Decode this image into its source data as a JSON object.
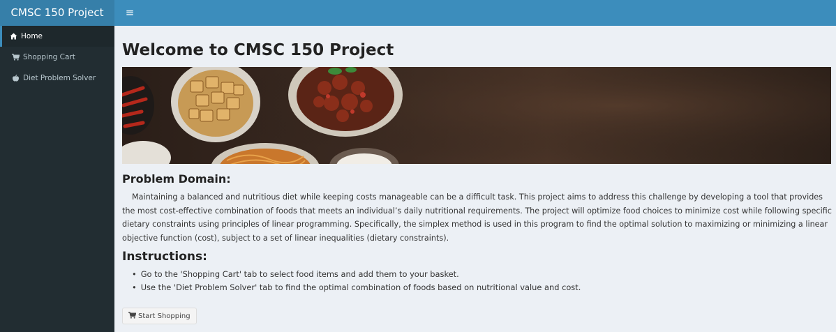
{
  "app": {
    "title": "CMSC 150 Project"
  },
  "navbar": {
    "toggle_icon": "hamburger-menu-icon"
  },
  "sidebar": {
    "items": [
      {
        "label": "Home",
        "icon": "home-icon",
        "active": true
      },
      {
        "label": "Shopping Cart",
        "icon": "shopping-cart-icon",
        "active": false
      },
      {
        "label": "Diet Problem Solver",
        "icon": "apple-icon",
        "active": false
      }
    ]
  },
  "main": {
    "heading": "Welcome to CMSC 150 Project",
    "problem_heading": "Problem Domain:",
    "problem_text": "Maintaining a balanced and nutritious diet while keeping costs manageable can be a difficult task. This project aims to address this challenge by developing a tool that provides the most cost-effective combination of foods that meets an individual’s daily nutritional requirements. The project will optimize food choices to minimize cost while following specific dietary constraints using principles of linear programming. Specifically, the simplex method is used in this program to find the optimal solution to maximizing or minimizing a linear objective function (cost), subject to a set of linear inequalities (dietary constraints).",
    "instructions_heading": "Instructions:",
    "instructions": [
      "Go to the 'Shopping Cart' tab to select food items and add them to your basket.",
      "Use the 'Diet Problem Solver' tab to find the optimal combination of foods based on nutritional value and cost."
    ],
    "start_button": "Start Shopping"
  },
  "colors": {
    "navbar": "#3c8dbc",
    "logo": "#367fa9",
    "sidebar": "#222d32",
    "content_bg": "#ecf0f5"
  }
}
